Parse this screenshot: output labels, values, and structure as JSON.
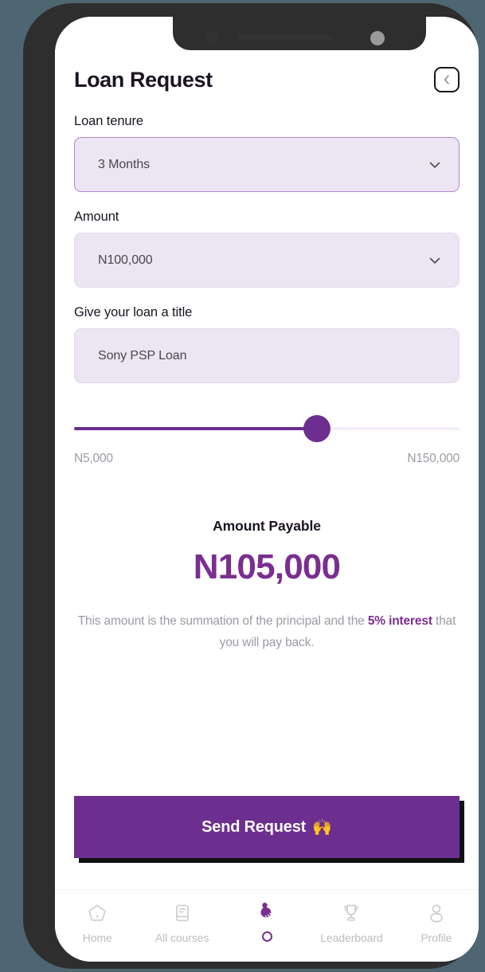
{
  "device": {
    "notch_camera_icon": "camera-dot",
    "frame_color": "#2e2e2e",
    "background_color": "#4d6672"
  },
  "theme": {
    "accent_purple": "#6d2f8f",
    "accent_purple_text": "#7a2e8f",
    "field_fill": "#ece5f3",
    "field_border_focused": "#b389cf",
    "muted_text": "#9e9aa3",
    "dark_text": "#1b1420"
  },
  "header": {
    "title": "Loan Request",
    "back_icon": "chevron-left-icon"
  },
  "form": {
    "tenure": {
      "label": "Loan tenure",
      "value": "3 Months",
      "chevron_icon": "chevron-down-icon",
      "focused": true
    },
    "amount": {
      "label": "Amount",
      "value": "N100,000",
      "chevron_icon": "chevron-down-icon",
      "focused": false
    },
    "title_field": {
      "label": "Give your loan a title",
      "value": "Sony PSP Loan",
      "placeholder": "Give your loan a title"
    }
  },
  "slider": {
    "min_label": "N5,000",
    "max_label": "N150,000",
    "min_value": 5000,
    "max_value": 150000,
    "current_value": 100000,
    "fill_percent": 63
  },
  "payable": {
    "title": "Amount Payable",
    "amount": "N105,000",
    "note_part1": "This amount is the summation of the principal and the ",
    "note_highlight": "5% interest",
    "note_part2": " that you will pay back."
  },
  "cta": {
    "label": "Send Request",
    "emoji": "🙌"
  },
  "bottom_nav": {
    "items": [
      {
        "label": "Home",
        "icon": "home-icon",
        "active": false
      },
      {
        "label": "All courses",
        "icon": "book-icon",
        "active": false
      },
      {
        "label": "",
        "icon": "hand-coins-icon",
        "active": true
      },
      {
        "label": "Leaderboard",
        "icon": "trophy-icon",
        "active": false
      },
      {
        "label": "Profile",
        "icon": "person-icon",
        "active": false
      }
    ]
  }
}
